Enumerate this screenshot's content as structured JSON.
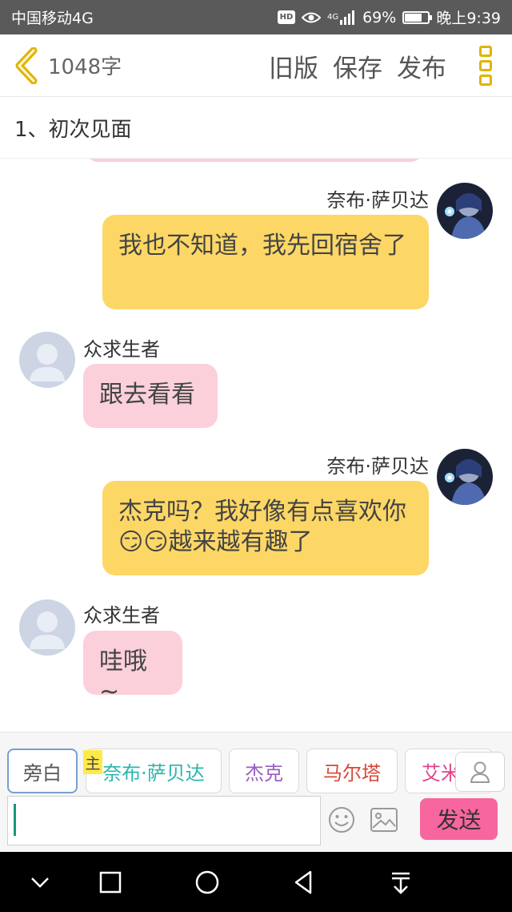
{
  "status_bar": {
    "carrier": "中国移动4G",
    "hd": "HD",
    "network": "4G",
    "battery": "69%",
    "battery_level": 0.69,
    "time": "晚上9:39"
  },
  "toolbar": {
    "word_count": "1048字",
    "old_version": "旧版",
    "save": "保存",
    "publish": "发布",
    "accent_color": "#e0b400"
  },
  "chapter": {
    "title": "1、初次见面"
  },
  "messages": [
    {
      "side": "right",
      "sender": "奈布·萨贝达",
      "text": "我也不知道，我先回宿舍了"
    },
    {
      "side": "left",
      "sender": "众求生者",
      "text": "跟去看看"
    },
    {
      "side": "right",
      "sender": "奈布·萨贝达",
      "text": "杰克吗？我好像有点喜欢你😏😏越来越有趣了"
    },
    {
      "side": "left",
      "sender": "众求生者",
      "text": "哇哦~"
    }
  ],
  "composer": {
    "roles": [
      {
        "label": "旁白",
        "color": "#555555"
      },
      {
        "label": "奈布·萨贝达",
        "color": "#2bb5ad"
      },
      {
        "label": "杰克",
        "color": "#9a5cc6"
      },
      {
        "label": "马尔塔",
        "color": "#d9473b"
      },
      {
        "label": "艾米",
        "color": "#e0428a"
      }
    ],
    "main_badge": "主",
    "input_value": "",
    "send": "发送",
    "send_color": "#f7669e"
  }
}
